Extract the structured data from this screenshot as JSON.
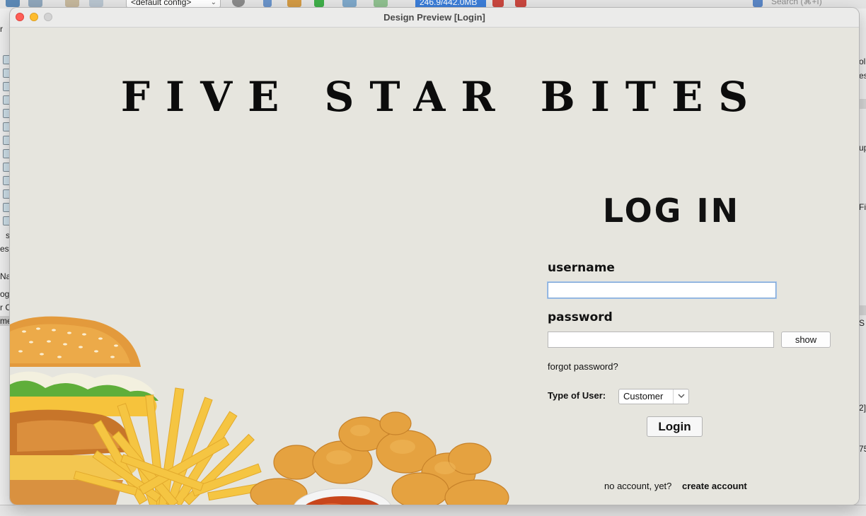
{
  "ide": {
    "config_value": "<default config>",
    "memory": "246.9/442.0MB",
    "search_placeholder": "Search (⌘+I)",
    "left_fragments": [
      "r",
      "s",
      "est",
      "Nav",
      "ogi",
      "r C",
      "me"
    ],
    "right_fragments": [
      "oli",
      "es",
      "up",
      "Fie",
      "S",
      "2]",
      "75"
    ]
  },
  "window": {
    "title": "Design Preview [Login]"
  },
  "brand": {
    "title": "FIVE STAR BITES"
  },
  "login": {
    "heading": "LOG IN",
    "username_label": "username",
    "username_value": "",
    "password_label": "password",
    "password_value": "",
    "show_label": "show",
    "forgot_label": "forgot password?",
    "user_type_label": "Type of User:",
    "user_type_value": "Customer",
    "login_label": "Login",
    "no_account_text": "no account, yet?",
    "create_account_label": "create account"
  },
  "image": {
    "icon": "burger-fries-nuggets-image"
  }
}
